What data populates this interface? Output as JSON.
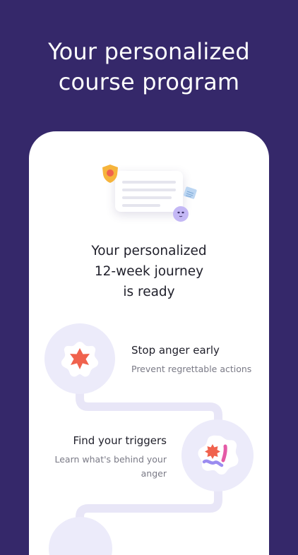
{
  "headline": {
    "line1": "Your personalized",
    "line2": "course program"
  },
  "card": {
    "title_line1": "Your personalized",
    "title_line2": "12-week journey",
    "title_line3": "is ready"
  },
  "steps": [
    {
      "title": "Stop anger early",
      "description": "Prevent regrettable actions"
    },
    {
      "title": "Find your triggers",
      "description_line1": "Learn what's behind your",
      "description_line2": "anger"
    }
  ],
  "colors": {
    "background": "#35286a",
    "card": "#ffffff",
    "circle": "#ecebfa",
    "path": "#e8e6f7",
    "accent_red": "#f0624d",
    "accent_purple": "#9b8cf0",
    "accent_pink": "#e45aa6"
  },
  "icons": [
    "shield-icon",
    "document-icon",
    "smiley-face-icon",
    "star-badge-icon",
    "triggers-icon"
  ]
}
